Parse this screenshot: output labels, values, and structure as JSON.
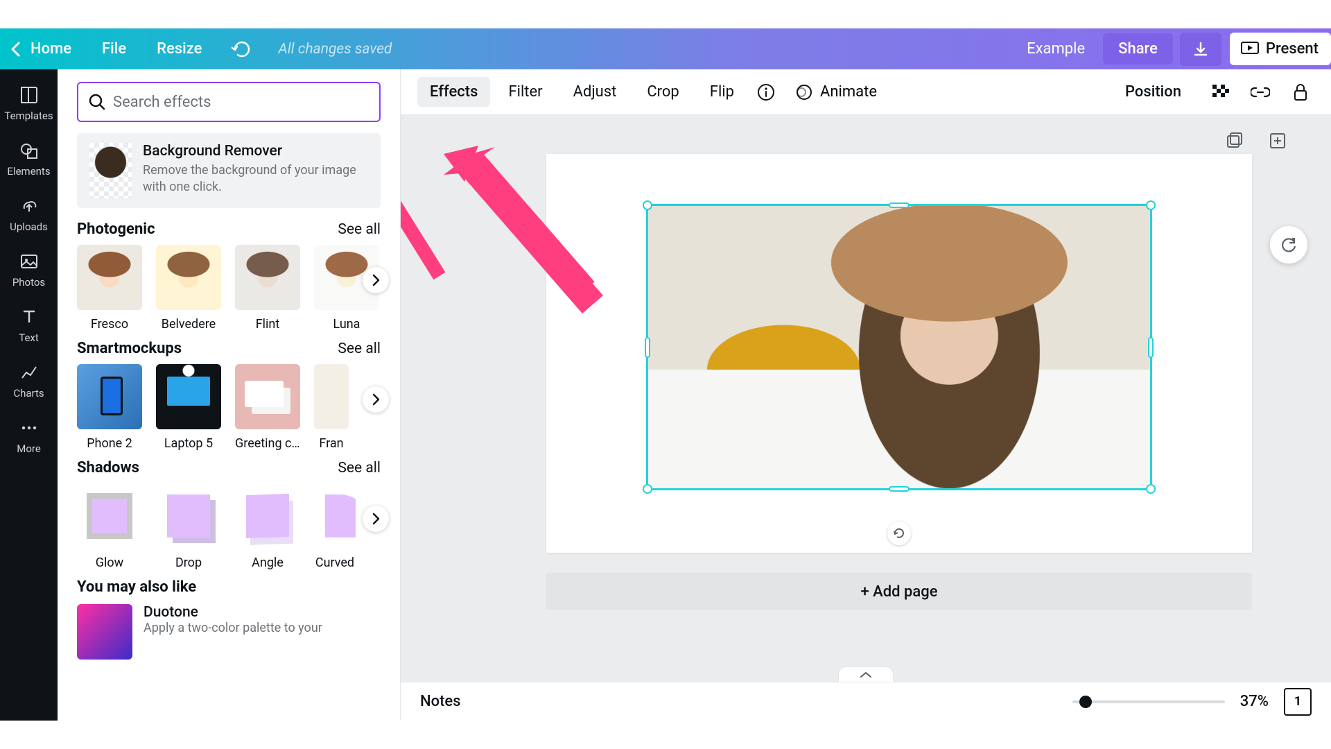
{
  "menubar": {
    "home": "Home",
    "file": "File",
    "resize": "Resize",
    "save_status": "All changes saved",
    "example": "Example",
    "share": "Share",
    "present": "Present"
  },
  "left_rail": [
    {
      "label": "Templates"
    },
    {
      "label": "Elements"
    },
    {
      "label": "Uploads"
    },
    {
      "label": "Photos"
    },
    {
      "label": "Text"
    },
    {
      "label": "Charts"
    },
    {
      "label": "More"
    }
  ],
  "effects_panel": {
    "search_placeholder": "Search effects",
    "bg_remover": {
      "title": "Background Remover",
      "description": "Remove the background of your image with one click."
    },
    "sections": {
      "photogenic": {
        "title": "Photogenic",
        "see_all": "See all",
        "items": [
          "Fresco",
          "Belvedere",
          "Flint",
          "Luna"
        ]
      },
      "smartmockups": {
        "title": "Smartmockups",
        "see_all": "See all",
        "items": [
          "Phone 2",
          "Laptop 5",
          "Greeting car…",
          "Fran"
        ]
      },
      "shadows": {
        "title": "Shadows",
        "see_all": "See all",
        "items": [
          "Glow",
          "Drop",
          "Angle",
          "Curved"
        ]
      },
      "you_may": {
        "title": "You may also like",
        "duotone_title": "Duotone",
        "duotone_sub": "Apply a two-color palette to your"
      }
    }
  },
  "toolbar": {
    "effects": "Effects",
    "filter": "Filter",
    "adjust": "Adjust",
    "crop": "Crop",
    "flip": "Flip",
    "animate": "Animate",
    "position": "Position"
  },
  "canvas": {
    "add_page": "+ Add page",
    "notes": "Notes",
    "zoom": "37%",
    "page_count": "1"
  }
}
